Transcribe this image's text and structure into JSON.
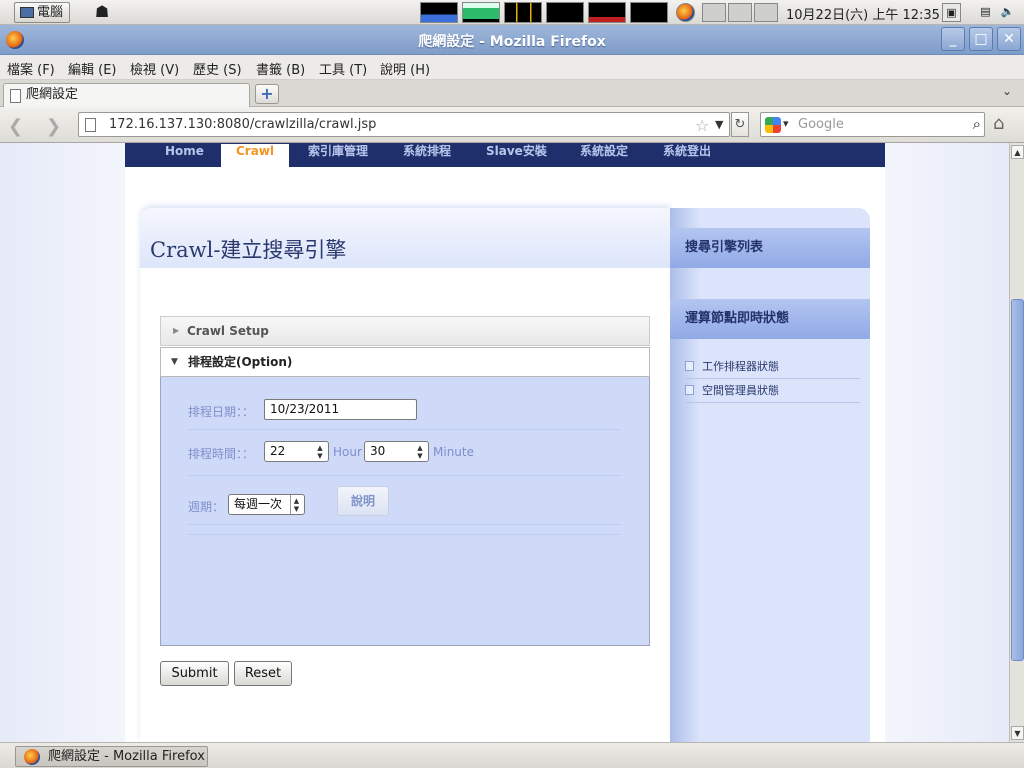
{
  "panel": {
    "computer_label": "電腦",
    "clock": "10月22日(六) 上午 12:35"
  },
  "window": {
    "title": "爬網設定 - Mozilla Firefox"
  },
  "menubar": {
    "items": [
      "檔案 (F)",
      "編輯 (E)",
      "檢視 (V)",
      "歷史 (S)",
      "書籤 (B)",
      "工具 (T)",
      "說明 (H)"
    ]
  },
  "tabs": {
    "active_tab": "爬網設定",
    "new_tab": "+"
  },
  "navbar": {
    "url": "172.16.137.130:8080/crawlzilla/crawl.jsp",
    "search_placeholder": "Google"
  },
  "site_nav": {
    "items": [
      "Home",
      "Crawl",
      "索引庫管理",
      "系統排程",
      "Slave安裝",
      "系統設定",
      "系統登出"
    ],
    "active": "Crawl"
  },
  "main": {
    "title": "Crawl-建立搜尋引擎",
    "panel_collapsed": "Crawl Setup",
    "panel_expanded": "排程設定(Option)",
    "form": {
      "date_label": "排程日期：：",
      "date_value": "10/23/2011",
      "time_label": "排程時間：：",
      "hour_value": "22",
      "hour_unit": "Hour",
      "minute_value": "30",
      "minute_unit": "Minute",
      "period_label": "週期：",
      "period_value": "每週一次",
      "explain_button": "說明"
    },
    "submit_label": "Submit",
    "reset_label": "Reset"
  },
  "sidebar": {
    "heading1": "搜尋引擎列表",
    "heading2": "運算節點即時狀態",
    "links": [
      "工作排程器狀態",
      "空間管理員狀態"
    ]
  },
  "taskbar": {
    "item": "爬網設定 - Mozilla Firefox"
  }
}
